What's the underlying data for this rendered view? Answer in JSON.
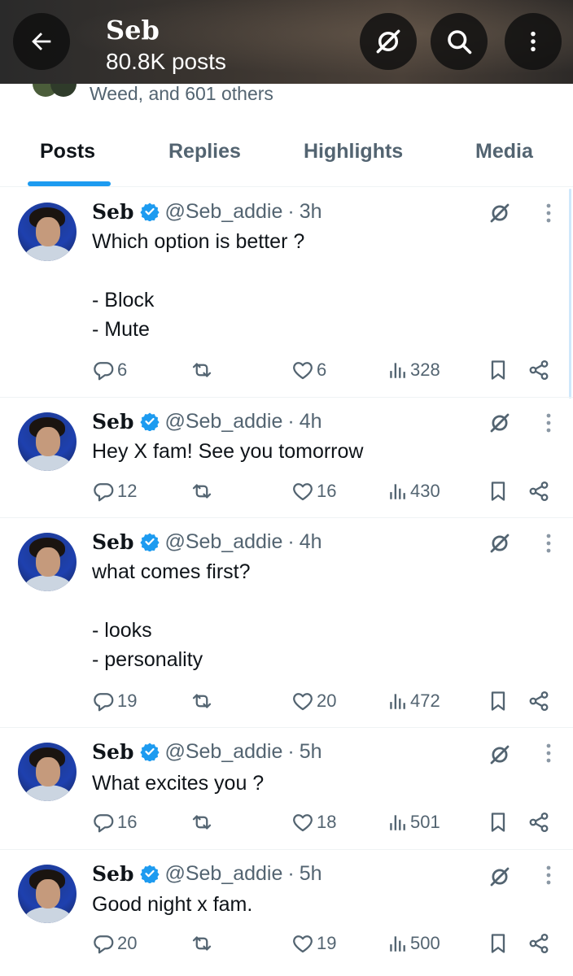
{
  "header": {
    "name": "Seb",
    "post_count": "80.8K posts",
    "icons": [
      "back-arrow-icon",
      "grok-icon",
      "search-icon",
      "more-vertical-icon"
    ]
  },
  "followed_by": {
    "text": "Weed, and 601 others"
  },
  "tabs": [
    {
      "label": "Posts",
      "active": true
    },
    {
      "label": "Replies",
      "active": false
    },
    {
      "label": "Highlights",
      "active": false
    },
    {
      "label": "Media",
      "active": false
    }
  ],
  "colors": {
    "accent": "#1d9bf0",
    "text": "#0f1419",
    "muted": "#536471"
  },
  "posts": [
    {
      "name": "Seb",
      "handle": "@Seb_addie",
      "sep": "·",
      "time": "3h",
      "text": "Which option is better ?\n\n- Block\n- Mute",
      "replies": "6",
      "reposts": "",
      "likes": "6",
      "views": "328"
    },
    {
      "name": "Seb",
      "handle": "@Seb_addie",
      "sep": "·",
      "time": "4h",
      "text": "Hey X fam! See you tomorrow",
      "replies": "12",
      "reposts": "",
      "likes": "16",
      "views": "430"
    },
    {
      "name": "Seb",
      "handle": "@Seb_addie",
      "sep": "·",
      "time": "4h",
      "text": "what comes first?\n\n- looks\n- personality",
      "replies": "19",
      "reposts": "",
      "likes": "20",
      "views": "472"
    },
    {
      "name": "Seb",
      "handle": "@Seb_addie",
      "sep": "·",
      "time": "5h",
      "text": "What excites you ?",
      "replies": "16",
      "reposts": "",
      "likes": "18",
      "views": "501"
    },
    {
      "name": "Seb",
      "handle": "@Seb_addie",
      "sep": "·",
      "time": "5h",
      "text": "Good night x fam.",
      "replies": "20",
      "reposts": "",
      "likes": "19",
      "views": "500"
    }
  ]
}
